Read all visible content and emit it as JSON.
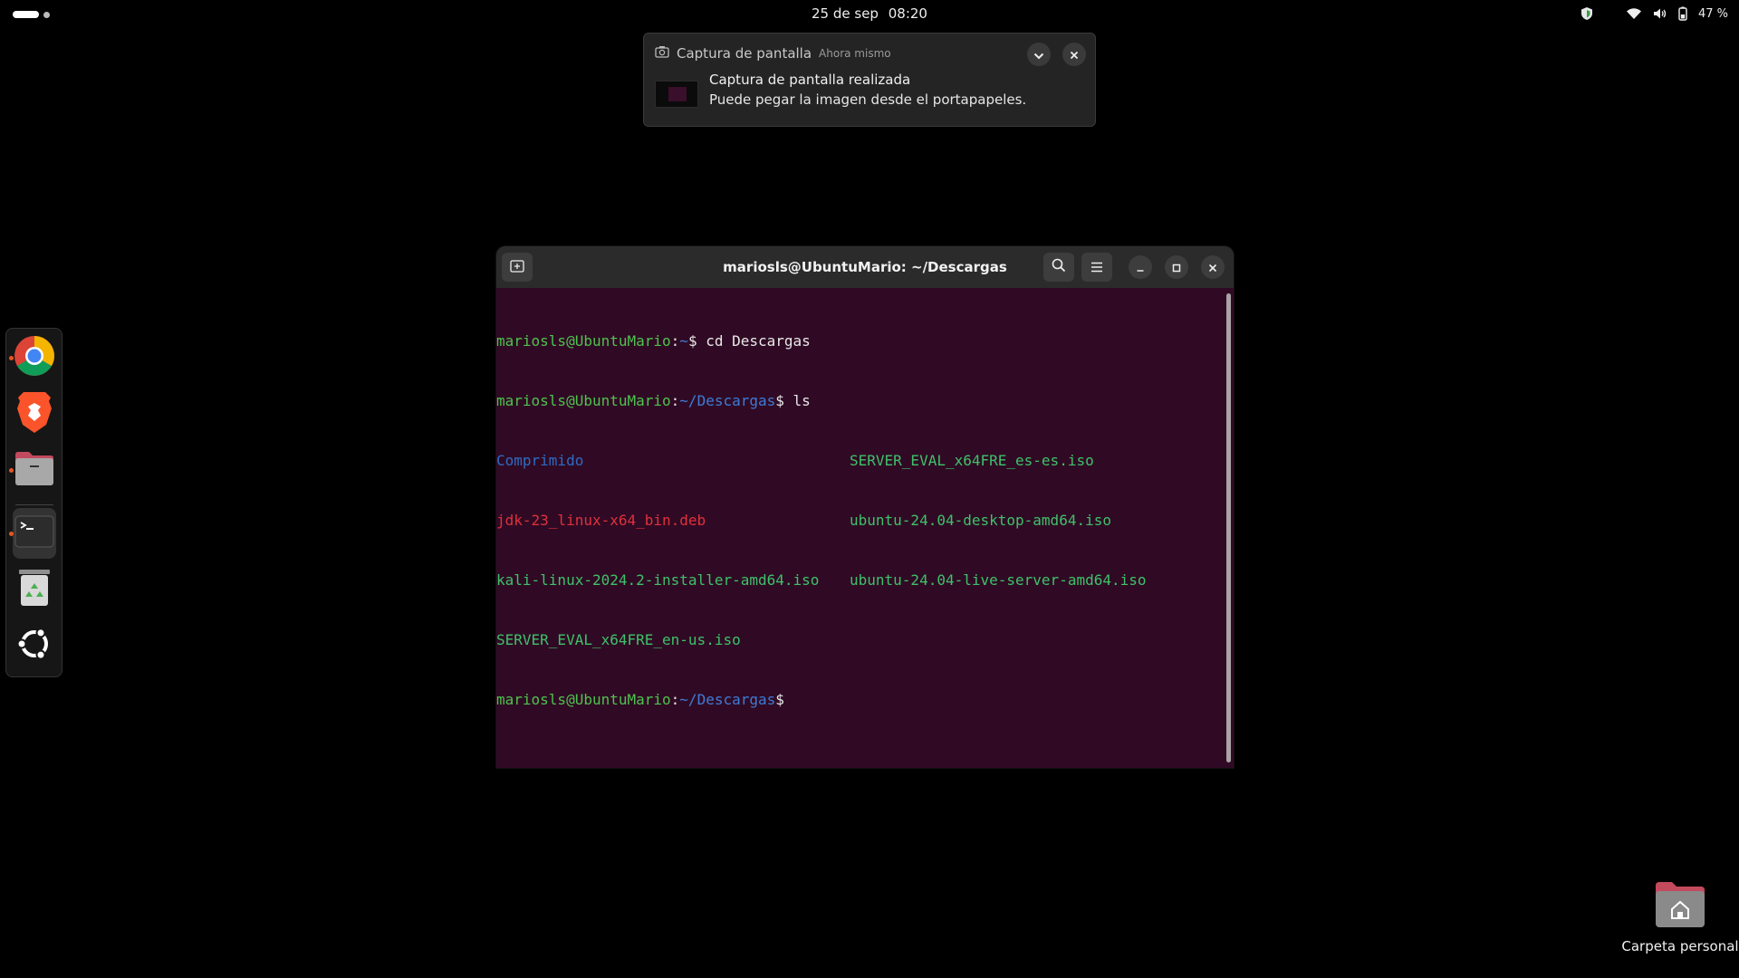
{
  "topbar": {
    "date": "25 de sep",
    "time": "08:20",
    "battery": "47 %"
  },
  "notification": {
    "app": "Captura de pantalla",
    "time": "Ahora mismo",
    "title": "Captura de pantalla realizada",
    "body": "Puede pegar la imagen desde el portapapeles."
  },
  "dock": {
    "items": [
      "chrome",
      "brave",
      "files",
      "terminal",
      "trash",
      "ubuntu-apps"
    ]
  },
  "terminal": {
    "title": "mariosls@UbuntuMario: ~/Descargas",
    "user": "mariosls@UbuntuMario",
    "colon": ":",
    "home": "~",
    "cwd": "~/Descargas",
    "prompt_sym": "$",
    "cmd1": " cd Descargas",
    "cmd2": " ls",
    "files": {
      "f1": "Comprimido",
      "f2": "jdk-23_linux-x64_bin.deb",
      "f3": "kali-linux-2024.2-installer-amd64.iso",
      "f4": "SERVER_EVAL_x64FRE_en-us.iso",
      "f5": "SERVER_EVAL_x64FRE_es-es.iso",
      "f6": "ubuntu-24.04-desktop-amd64.iso",
      "f7": "ubuntu-24.04-live-server-amd64.iso"
    }
  },
  "desktop": {
    "home_label": "Carpeta personal"
  },
  "colors": {
    "terminal_bg": "#300a24",
    "prompt_user": "#4ec24e",
    "prompt_path": "#3f7bd6",
    "directory": "#2e6bc4",
    "deb_file": "#e0303c",
    "iso_file": "#3ec16a",
    "accent": "#e95420"
  }
}
